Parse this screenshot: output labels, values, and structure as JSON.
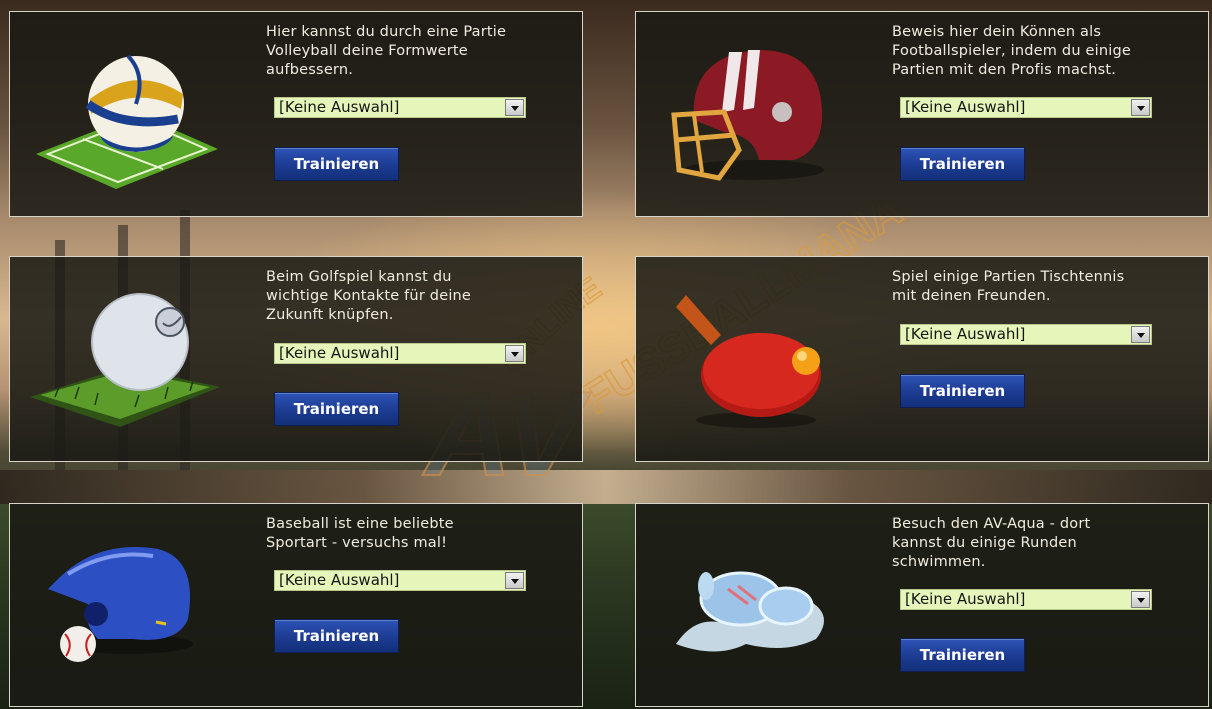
{
  "select_placeholder": "[Keine Auswahl]",
  "train_label": "Trainieren",
  "watermark": {
    "line1": "ONLINE",
    "line2": "FUSSBALLMANAGER",
    "logo": "AV"
  },
  "cards": [
    {
      "sport": "volleyball",
      "icon": "volleyball-icon",
      "lines": [
        "Hier kannst du durch eine Partie",
        "Volleyball deine Formwerte",
        "aufbessern."
      ]
    },
    {
      "sport": "football",
      "icon": "football-helmet-icon",
      "lines": [
        "Beweis hier dein Können als",
        "Footballspieler, indem du einige",
        "Partien mit den Profis machst."
      ]
    },
    {
      "sport": "golf",
      "icon": "golf-ball-icon",
      "lines": [
        "Beim Golfspiel kannst du",
        "wichtige Kontakte für deine",
        "Zukunft knüpfen."
      ]
    },
    {
      "sport": "table-tennis",
      "icon": "table-tennis-paddle-icon",
      "lines": [
        "Spiel einige Partien Tischtennis",
        "mit deinen Freunden."
      ]
    },
    {
      "sport": "baseball",
      "icon": "baseball-helmet-icon",
      "lines": [
        "Baseball ist eine beliebte",
        "Sportart - versuchs mal!"
      ]
    },
    {
      "sport": "swimming",
      "icon": "swimming-goggles-icon",
      "lines": [
        "Besuch den AV-Aqua - dort",
        "kannst du einige Runden",
        "schwimmen."
      ]
    }
  ]
}
